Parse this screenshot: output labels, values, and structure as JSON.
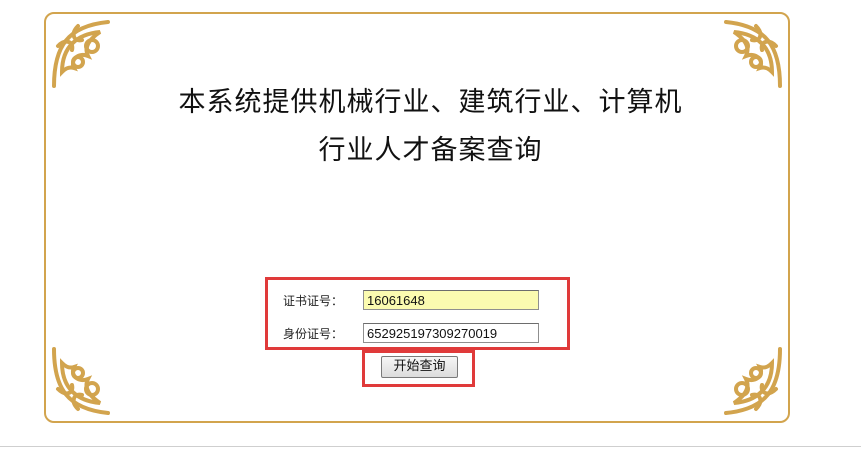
{
  "heading": {
    "line1": "本系统提供机械行业、建筑行业、计算机",
    "line2": "行业人才备案查询"
  },
  "form": {
    "cert_label": "证书证号：",
    "cert_value": "16061648",
    "id_label": "身份证号：",
    "id_value": "652925197309270019",
    "submit_label": "开始查询"
  },
  "colors": {
    "frame": "#d2a44e",
    "highlight_box": "#e03a3a",
    "autofill_bg": "#fbfbb0"
  }
}
